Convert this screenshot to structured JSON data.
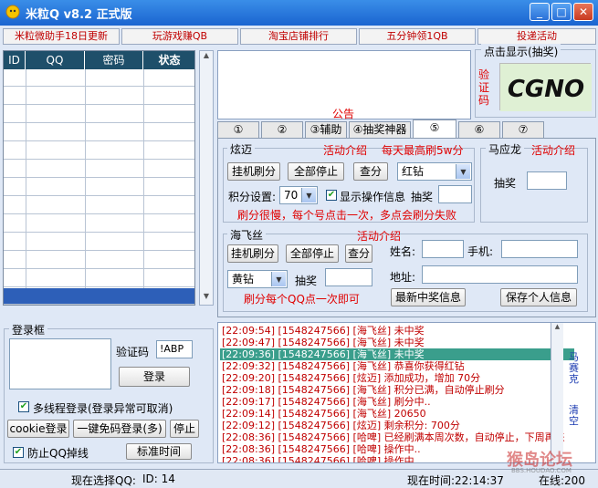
{
  "window": {
    "title": "米粒Q v8.2 正式版"
  },
  "toplinks": [
    {
      "label": "米粒微助手18日更新"
    },
    {
      "label": "玩游戏赚QB"
    },
    {
      "label": "淘宝店铺排行"
    },
    {
      "label": "五分钟领1QB"
    },
    {
      "label": "投递活动"
    }
  ],
  "table": {
    "columns": [
      "ID",
      "QQ",
      "密码",
      "状态"
    ]
  },
  "notice": {
    "label": "公告"
  },
  "captcha": {
    "title": "点击显示(抽奖)",
    "side_label": "验证码",
    "image_text": "CGNO"
  },
  "tabs": [
    "①",
    "②",
    "③辅助",
    "④抽奖神器",
    "⑤",
    "⑥",
    "⑦"
  ],
  "xuanmai": {
    "title": "炫迈",
    "activity": "活动介绍",
    "daily": "每天最高刷5w分",
    "btn_hang": "挂机刷分",
    "btn_stop": "全部停止",
    "btn_score": "查分",
    "select_value": "红钻",
    "score_label": "积分设置:",
    "score_value": "70",
    "show_info": "显示操作信息",
    "lottery": "抽奖",
    "note": "刷分很慢，每个号点击一次，多点会刷分失败"
  },
  "malong": {
    "title": "马应龙",
    "activity": "活动介绍",
    "lottery": "抽奖"
  },
  "haifeisi": {
    "title": "海飞丝",
    "activity": "活动介绍",
    "btn_hang": "挂机刷分",
    "btn_stop": "全部停止",
    "btn_score": "查分",
    "select_value": "黄钻",
    "lottery": "抽奖",
    "note": "刷分每个QQ点一次即可",
    "name_label": "姓名:",
    "phone_label": "手机:",
    "address_label": "地址:",
    "btn_latest": "最新中奖信息",
    "btn_save": "保存个人信息"
  },
  "login": {
    "title": "登录框",
    "captcha_label": "验证码",
    "captcha_value": "!ABP",
    "btn_login": "登录",
    "multi_thread": "多线程登录(登录异常可取消)",
    "btn_cookie": "cookie登录",
    "btn_onekey": "一键免码登录(多)",
    "btn_stop": "停止",
    "prevent_drop": "防止QQ掉线",
    "btn_time": "标准时间"
  },
  "log": {
    "lines": [
      "[22:09:54] [1548247566] [海飞丝] 未中奖",
      "[22:09:47] [1548247566] [海飞丝] 未中奖",
      "[22:09:36] [1548247566] [海飞丝] 未中奖",
      "[22:09:32] [1548247566] [海飞丝] 恭喜你获得红钻",
      "[22:09:20] [1548247566] [炫迈] 添加成功，增加 70分",
      "[22:09:18] [1548247566] [海飞丝] 积分已满，自动停止刷分",
      "[22:09:17] [1548247566] [海飞丝] 刷分中..",
      "[22:09:14] [1548247566] [海飞丝] 20650",
      "[22:09:12] [1548247566] [炫迈] 剩余积分: 700分",
      "[22:08:36] [1548247566] [哈啤] 已经刷满本周次数，自动停止，下周再来",
      "[22:08:36] [1548247566] [哈啤] 操作中..",
      "[22:08:36] [1548247566] [哈啤] 操作中"
    ],
    "selected_index": 2,
    "side_btn1": "马赛克",
    "side_btn2": "清空"
  },
  "status": {
    "current_qq_label": "现在选择QQ:",
    "id_label": "ID: 14",
    "time_label": "现在时间:22:14:37",
    "online_label": "在线:200"
  },
  "watermark": {
    "text": "猴岛论坛",
    "sub": "BBS.HOUDAO.COM"
  },
  "colors": {
    "accent": "#e00000",
    "title_bar": "#1a64d0",
    "table_header": "#1e4f6a",
    "selection": "#2d5fb8"
  }
}
